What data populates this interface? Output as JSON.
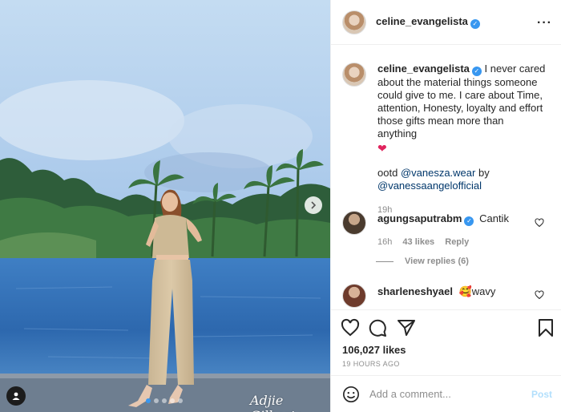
{
  "post": {
    "author": "celine_evangelista",
    "verified": true,
    "photo_watermark": "Adjie Gilberto",
    "carousel": {
      "count": 5,
      "active_index": 0
    }
  },
  "caption": {
    "author": "celine_evangelista",
    "text": "I never cared about the material things someone could give to me. I care about Time, attention, Honesty, loyalty and effort those gifts mean more than anything",
    "emoji": "❤",
    "ootd_prefix": "ootd",
    "mention_1": "@vanesza.wear",
    "by": "by",
    "mention_2": "@vanessaangelofficial",
    "time": "19h"
  },
  "comments": [
    {
      "author": "agungsaputrabm",
      "verified": true,
      "text": "Cantik",
      "time": "16h",
      "likes": "43 likes",
      "reply": "Reply",
      "view_replies": "View replies (6)"
    },
    {
      "author": "sharleneshyael",
      "verified": false,
      "emoji": "🥰",
      "text": "wavy"
    }
  ],
  "engagement": {
    "likes": "106,027 likes",
    "time_ago": "19 HOURS AGO"
  },
  "add_comment": {
    "placeholder": "Add a comment...",
    "post_label": "Post"
  },
  "colors": {
    "accent": "#3897f0",
    "mention": "#00376b",
    "muted": "#8e8e8e",
    "heart": "#e0245e",
    "post_disabled": "#b2dffc"
  },
  "icons": [
    "more-options-icon",
    "verified-icon",
    "heart-icon",
    "comment-icon",
    "share-icon",
    "bookmark-icon",
    "emoji-icon",
    "next-arrow-icon",
    "user-tag-icon"
  ]
}
